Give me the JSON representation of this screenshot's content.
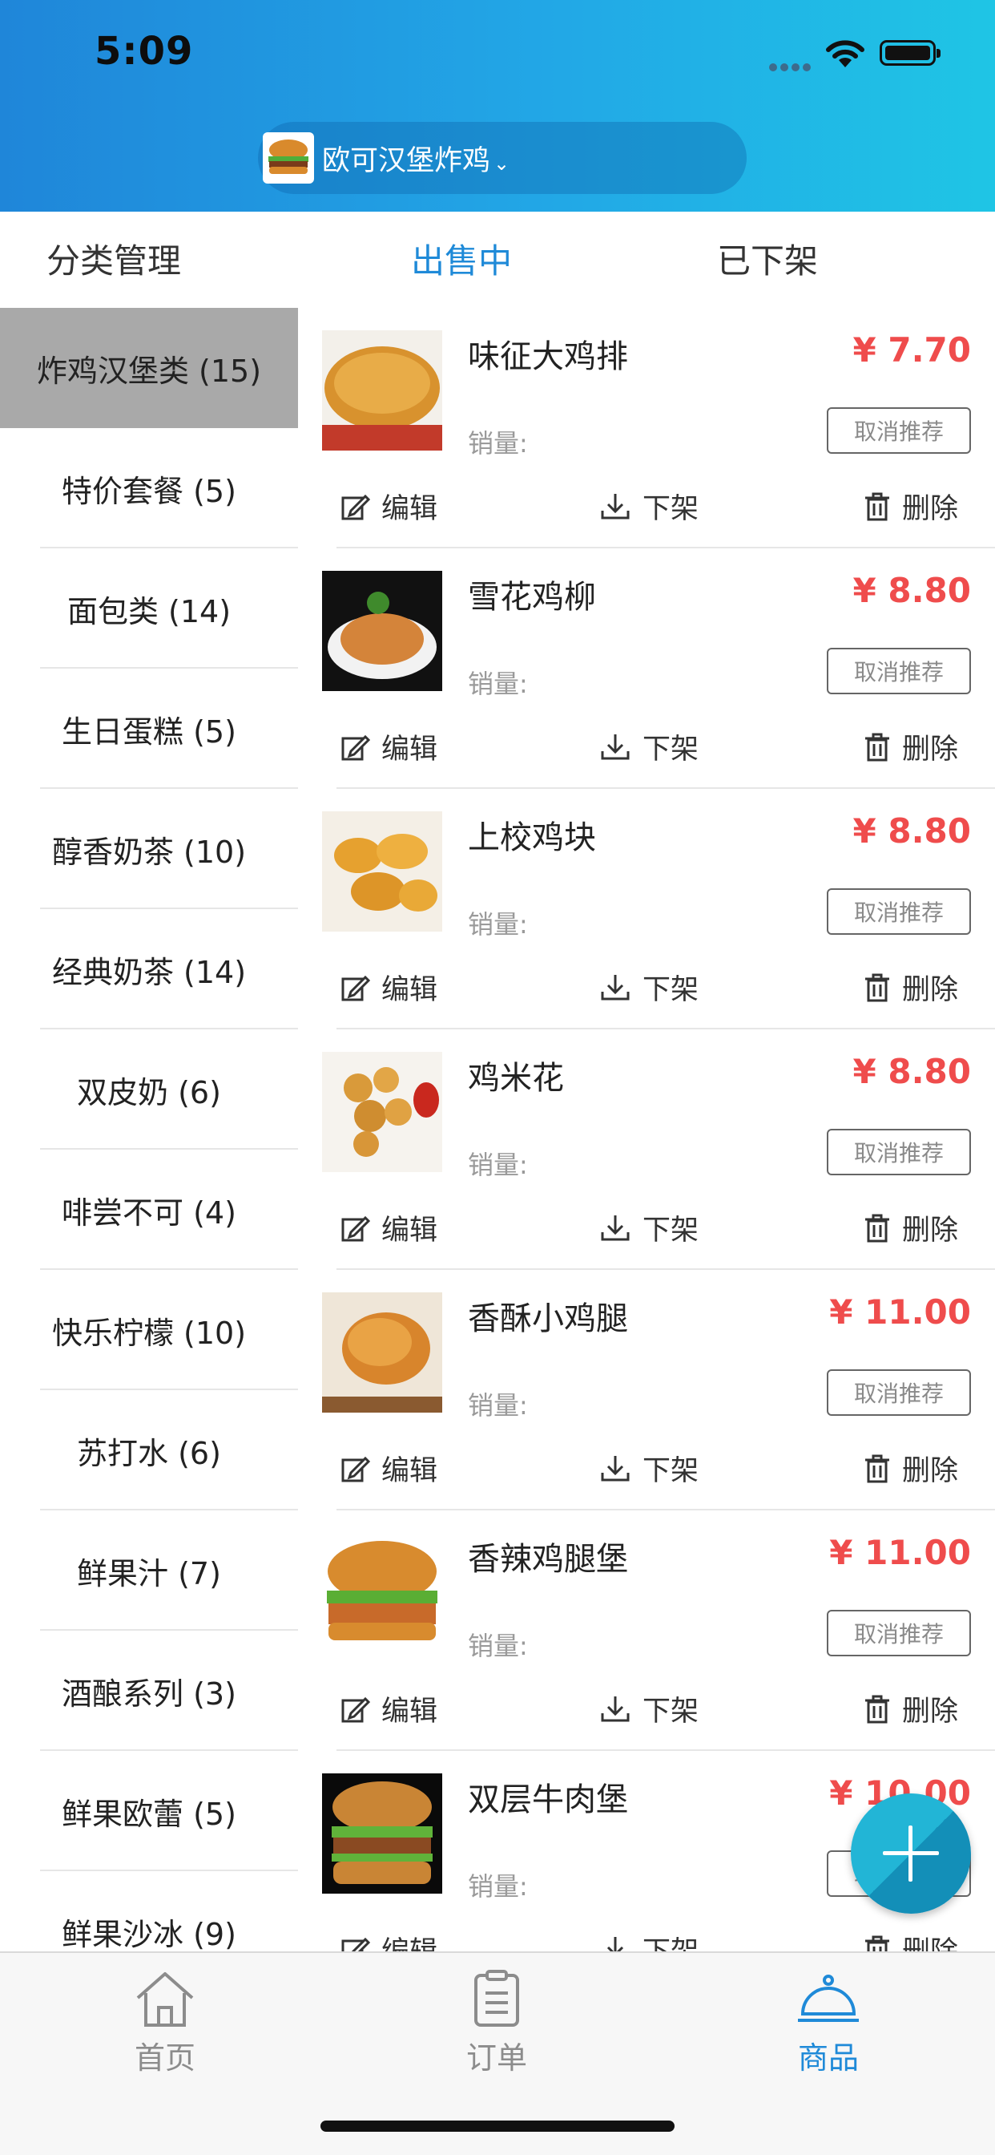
{
  "status_bar": {
    "time": "5:09"
  },
  "header": {
    "store_name": "欧可汉堡炸鸡",
    "dropdown_icon": "chevron-down-icon"
  },
  "tabs": {
    "category_mgmt": "分类管理",
    "on_sale": "出售中",
    "off_shelf": "已下架",
    "active": "on_sale"
  },
  "categories": [
    {
      "label": "炸鸡汉堡类 (15)",
      "active": true
    },
    {
      "label": "特价套餐 (5)"
    },
    {
      "label": "面包类 (14)"
    },
    {
      "label": "生日蛋糕 (5)"
    },
    {
      "label": "醇香奶茶 (10)"
    },
    {
      "label": "经典奶茶 (14)"
    },
    {
      "label": "双皮奶 (6)"
    },
    {
      "label": "啡尝不可 (4)"
    },
    {
      "label": "快乐柠檬 (10)"
    },
    {
      "label": "苏打水 (6)"
    },
    {
      "label": "鲜果汁 (7)"
    },
    {
      "label": "酒酿系列 (3)"
    },
    {
      "label": "鲜果欧蕾 (5)"
    },
    {
      "label": "鲜果沙冰 (9)"
    }
  ],
  "labels": {
    "sales": "销量:",
    "cancel_recommend": "取消推荐",
    "edit": "编辑",
    "unlist": "下架",
    "delete": "删除"
  },
  "products": [
    {
      "name": "味征大鸡排",
      "price": "¥ 7.70"
    },
    {
      "name": "雪花鸡柳",
      "price": "¥ 8.80"
    },
    {
      "name": "上校鸡块",
      "price": "¥ 8.80"
    },
    {
      "name": "鸡米花",
      "price": "¥ 8.80"
    },
    {
      "name": "香酥小鸡腿",
      "price": "¥ 11.00"
    },
    {
      "name": "香辣鸡腿堡",
      "price": "¥ 11.00"
    },
    {
      "name": "双层牛肉堡",
      "price": "¥ 10.00"
    }
  ],
  "tabbar": {
    "home": "首页",
    "orders": "订单",
    "products": "商品",
    "active": "products"
  },
  "colors": {
    "accent": "#1f8ad8",
    "price": "#ef4c4c",
    "header_start": "#1f86d9",
    "header_end": "#1fc5e5",
    "active_category_bg": "#a9a9a9"
  }
}
